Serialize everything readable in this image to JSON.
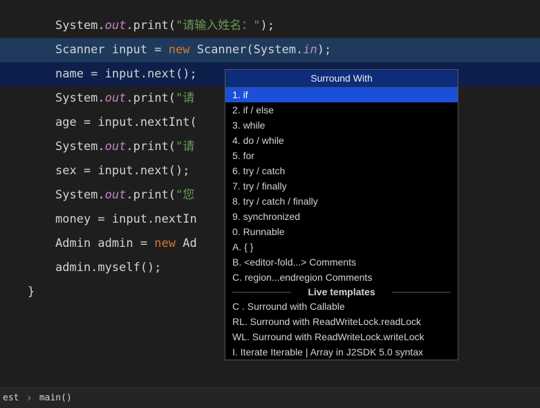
{
  "code": {
    "l0": {
      "prefix": "System.",
      "field": "out",
      "call": ".print(",
      "str": "\"请输入姓名：\"",
      "suffix": ");"
    },
    "l1": {
      "t1": "Scanner input = ",
      "kw": "new",
      "t2": " Scanner(System.",
      "field": "in",
      "t3": ");"
    },
    "l2": "name = input.next();",
    "l3": {
      "prefix": "System.",
      "field": "out",
      "call": ".print(",
      "str": "\"请"
    },
    "l4": "age = input.nextInt(",
    "l5": {
      "prefix": "System.",
      "field": "out",
      "call": ".print(",
      "str": "\"请"
    },
    "l6": "sex = input.next();",
    "l7": {
      "prefix": "System.",
      "field": "out",
      "call": ".print(",
      "str": "\"您"
    },
    "l8": "money = input.nextIn",
    "l9": {
      "t1": "Admin admin = ",
      "kw": "new",
      "t2": " Ad"
    },
    "l10": "admin.myself();",
    "l11": "}"
  },
  "popup": {
    "title": "Surround With",
    "items": [
      "1. if",
      "2. if / else",
      "3. while",
      "4. do / while",
      "5. for",
      "6. try / catch",
      "7. try / finally",
      "8. try / catch / finally",
      "9. synchronized",
      "0. Runnable",
      "A. { }",
      "B. <editor-fold...> Comments",
      "C. region...endregion Comments"
    ],
    "section": "Live templates",
    "live": [
      "C . Surround with Callable",
      "RL. Surround with ReadWriteLock.readLock",
      "WL. Surround with ReadWriteLock.writeLock",
      "I. Iterate Iterable | Array in J2SDK 5.0 syntax"
    ]
  },
  "breadcrumb": {
    "item1": "est",
    "item2": "main()"
  }
}
